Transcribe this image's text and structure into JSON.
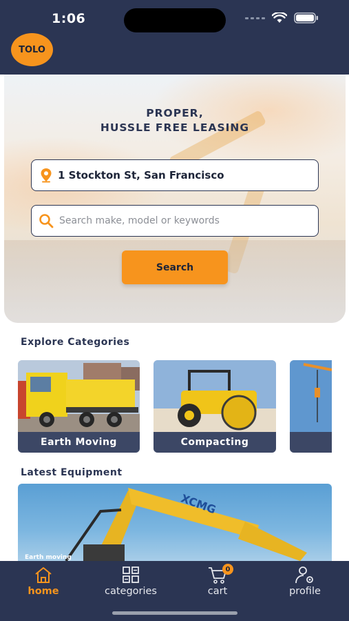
{
  "status_bar": {
    "time": "1:06"
  },
  "brand": {
    "logo_text": "TOLO",
    "accent_color": "#f7941d",
    "primary_color": "#2b3553"
  },
  "hero": {
    "title_line1": "PROPER,",
    "title_line2": "HUSSLE FREE LEASING",
    "location_value": "1 Stockton St, San Francisco",
    "location_icon": "map-pin-icon",
    "search_placeholder": "Search make, model or keywords",
    "search_icon": "search-icon",
    "search_button_label": "Search"
  },
  "categories": {
    "title": "Explore Categories",
    "items": [
      {
        "label": "Earth Moving"
      },
      {
        "label": "Compacting"
      },
      {
        "label": ""
      }
    ]
  },
  "latest": {
    "title": "Latest Equipment",
    "items": [
      {
        "tag": "Earth moving",
        "brand_text": "XCMG"
      }
    ]
  },
  "bottom_nav": {
    "items": [
      {
        "label": "home",
        "icon": "home-icon",
        "active": true
      },
      {
        "label": "categories",
        "icon": "grid-icon",
        "active": false
      },
      {
        "label": "cart",
        "icon": "cart-icon",
        "active": false,
        "badge": "0"
      },
      {
        "label": "profile",
        "icon": "profile-settings-icon",
        "active": false
      }
    ]
  }
}
